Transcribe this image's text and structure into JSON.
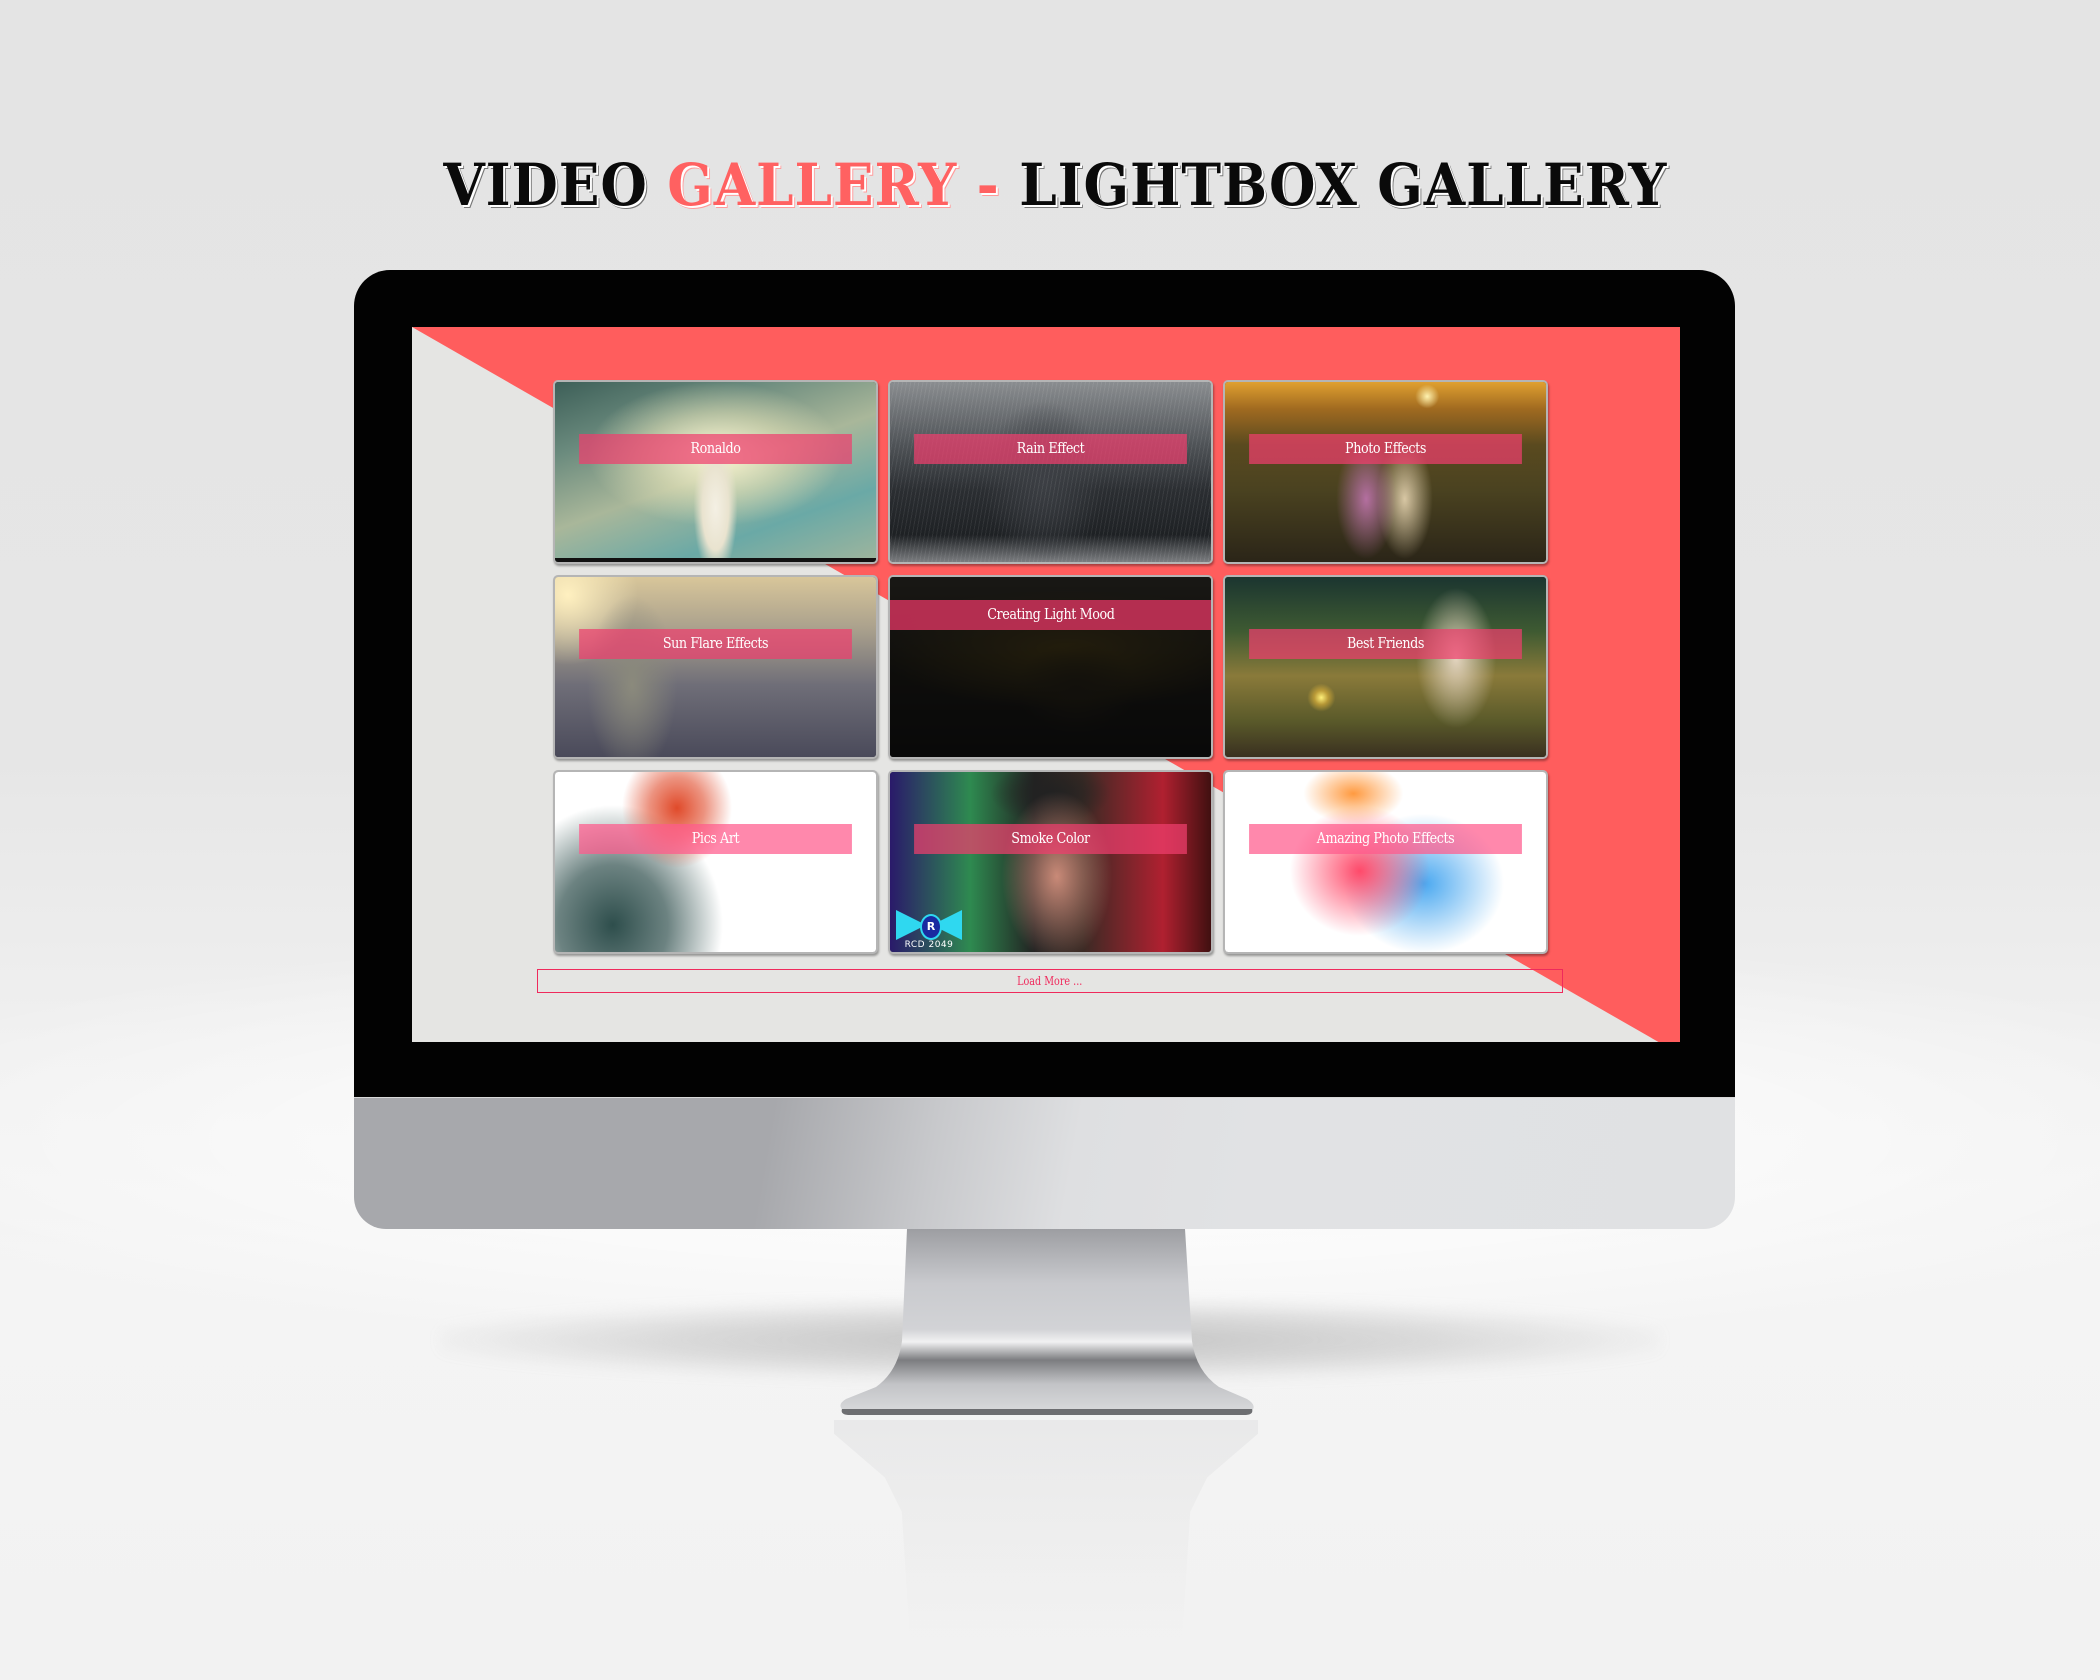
{
  "title": {
    "part1": "VIDEO ",
    "part2": "GALLERY",
    "part3": " - ",
    "part4": "LIGHTBOX GALLERY"
  },
  "colors": {
    "accent": "#ff6161",
    "screen_bg": "#e5e5e3",
    "screen_red": "#ff5d5d",
    "caption_band": "#ef3e6e",
    "load_more_border": "#ef2a5c"
  },
  "gallery": {
    "items": [
      {
        "label": "Ronaldo",
        "state": "normal"
      },
      {
        "label": "Rain Effect",
        "state": "normal"
      },
      {
        "label": "Photo Effects",
        "state": "normal"
      },
      {
        "label": "Sun Flare Effects",
        "state": "normal"
      },
      {
        "label": "Creating Light Mood",
        "state": "hover"
      },
      {
        "label": "Best Friends",
        "state": "normal"
      },
      {
        "label": "Pics Art",
        "state": "normal"
      },
      {
        "label": "Smoke Color",
        "state": "normal"
      },
      {
        "label": "Amazing Photo Effects",
        "state": "normal"
      }
    ],
    "watermark": "RCD 2049",
    "watermark_letter": "R",
    "load_more_label": "Load More ..."
  }
}
